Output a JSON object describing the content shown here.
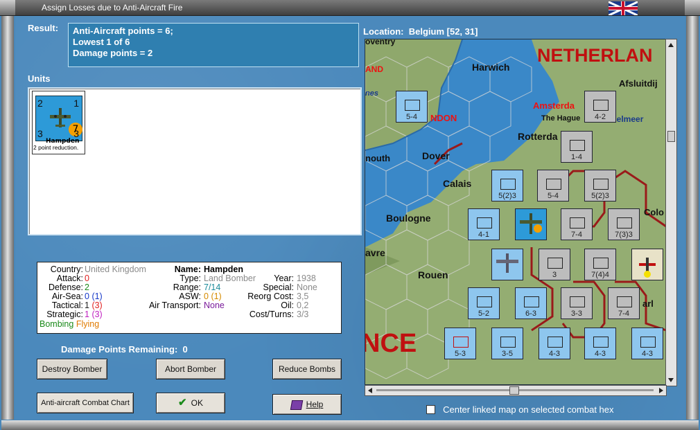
{
  "window": {
    "title": "Assign Losses due to Anti-Aircraft Fire"
  },
  "result": {
    "label": "Result:",
    "lines": [
      "Anti-Aircraft points = 6;",
      "Lowest 1 of 6",
      "Damage points = 2"
    ]
  },
  "units": {
    "label": "Units",
    "card": {
      "name": "Hampden",
      "tl": "2",
      "tr": "1",
      "bl": "3",
      "br": "3",
      "badge": "7",
      "note": "2 point reduction."
    }
  },
  "info": {
    "country_label": "Country:",
    "country": "United Kingdom",
    "attack_label": "Attack:",
    "attack": "0",
    "defense_label": "Defense:",
    "defense": "2",
    "airsea_label": "Air-Sea:",
    "airsea": "0",
    "airsea_paren": "(1)",
    "tactical_label": "Tactical:",
    "tactical": "1",
    "tactical_paren": "(3)",
    "strategic_label": "Strategic:",
    "strategic": "1",
    "strategic_paren": "(3)",
    "mode1": "Bombing",
    "mode2": "Flying",
    "name_label": "Name:",
    "name": "Hampden",
    "type_label": "Type:",
    "type": "Land Bomber",
    "year_label": "Year:",
    "year": "1938",
    "range_label": "Range:",
    "range": "7/14",
    "special_label": "Special:",
    "special": "None",
    "asw_label": "ASW:",
    "asw": "0",
    "asw_paren": "(1)",
    "reorg_label": "Reorg Cost:",
    "reorg": "3,5",
    "airtransport_label": "Air Transport:",
    "airtransport": "None",
    "oil_label": "Oil:",
    "oil": "0,2",
    "costturns_label": "Cost/Turns:",
    "costturns": "3/3"
  },
  "damage": {
    "label": "Damage Points Remaining:",
    "value": "0"
  },
  "buttons": {
    "destroy": "Destroy Bomber",
    "abort": "Abort Bomber",
    "reduce": "Reduce Bombs",
    "chart": "Anti-aircraft Combat Chart",
    "ok": "OK",
    "help": "Help"
  },
  "location": {
    "label": "Location:",
    "value": "Belgium [52, 31]"
  },
  "map": {
    "country_top": "NETHERLAN",
    "country_bottom": "NCE",
    "cities": [
      "Harwich",
      "Afsluitdij",
      "Amsterda",
      "The Hague",
      "selmeer",
      "Rotterda",
      "NDON",
      "Dover",
      "nouth",
      "Calais",
      "Boulogne",
      "avre",
      "Rouen",
      "Colo",
      "arl",
      "AND",
      "nes",
      "oventry"
    ],
    "counters": [
      "5-4",
      "4-2",
      "1-4",
      "5(2)3",
      "5-4",
      "5(2)3",
      "4-1",
      "7-4",
      "7(3)3",
      "3",
      "7(4)4",
      "5-2",
      "6-3",
      "3-3",
      "7-4",
      "5-3",
      "3-5",
      "4-3",
      "4-3",
      "4-3"
    ]
  },
  "footer": {
    "center_checkbox_label": "Center linked map on selected combat hex"
  }
}
